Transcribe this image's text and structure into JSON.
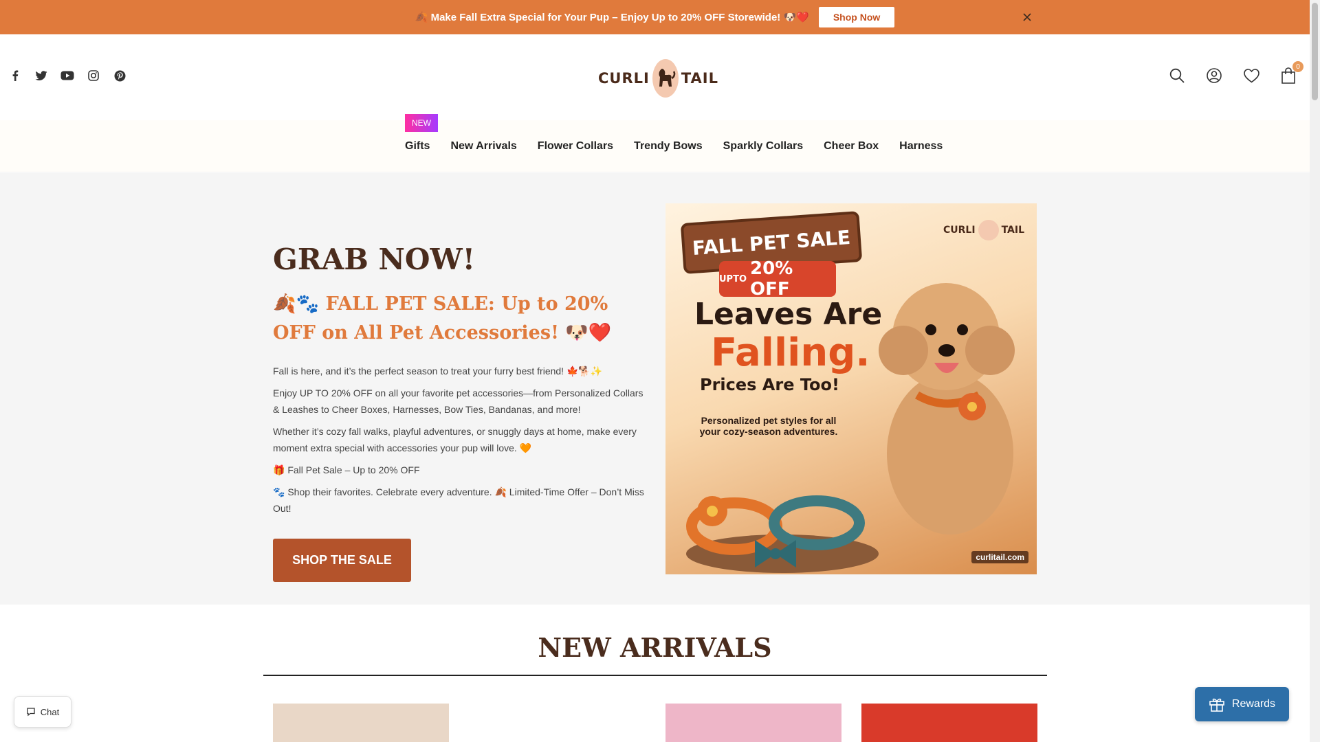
{
  "announcement": {
    "text": "🍂 Make Fall Extra Special for Your Pup – Enjoy Up to 20% OFF Storewide! 🐶❤️",
    "button_label": "Shop Now",
    "close_icon": "close-icon"
  },
  "header": {
    "logo_left": "CURLI",
    "logo_right": "TAIL",
    "social_icons": [
      "facebook-icon",
      "twitter-icon",
      "youtube-icon",
      "instagram-icon",
      "pinterest-icon"
    ],
    "cart_count": "0"
  },
  "nav": {
    "new_badge": "NEW",
    "items": [
      {
        "label": "Gifts"
      },
      {
        "label": "New Arrivals"
      },
      {
        "label": "Flower Collars"
      },
      {
        "label": "Trendy Bows"
      },
      {
        "label": "Sparkly Collars"
      },
      {
        "label": "Cheer Box"
      },
      {
        "label": "Harness"
      }
    ]
  },
  "hero": {
    "title": "GRAB NOW!",
    "subtitle": "🍂🐾 FALL PET SALE: Up to 20% OFF on All Pet Accessories! 🐶❤️",
    "paragraphs": [
      "Fall is here, and it’s the perfect season to treat your furry best friend! 🍁🐕✨",
      "Enjoy UP TO 20% OFF on all your favorite pet accessories—from Personalized Collars & Leashes to Cheer Boxes, Harnesses, Bow Ties, Bandanas, and more!",
      "Whether it’s cozy fall walks, playful adventures, or snuggly days at home, make every moment extra special with accessories your pup will love. 🧡",
      "🎁 Fall Pet Sale – Up to 20% OFF",
      "🐾 Shop their favorites. Celebrate every adventure. 🍂 Limited-Time Offer – Don’t Miss Out!"
    ],
    "cta_label": "SHOP THE SALE",
    "promo": {
      "sign": "FALL PET SALE",
      "badge_prefix": "UPTO",
      "badge_value": "20% OFF",
      "logo_left": "CURLI",
      "logo_right": "TAIL",
      "headline1": "Leaves Are",
      "headline2": "Falling.",
      "headline3": "Prices Are Too!",
      "tagline": "Personalized pet styles for all your cozy-season adventures.",
      "url": "curlitail.com"
    }
  },
  "new_arrivals": {
    "title": "NEW ARRIVALS"
  },
  "chat": {
    "label": "Chat"
  },
  "rewards": {
    "label": "Rewards"
  },
  "colors": {
    "announcement_bg": "#e07a3c",
    "hero_title": "#4a2c1d",
    "hero_subtitle": "#e07a3c",
    "cta_bg": "#b4532b",
    "rewards_bg": "#2d6fa8"
  }
}
